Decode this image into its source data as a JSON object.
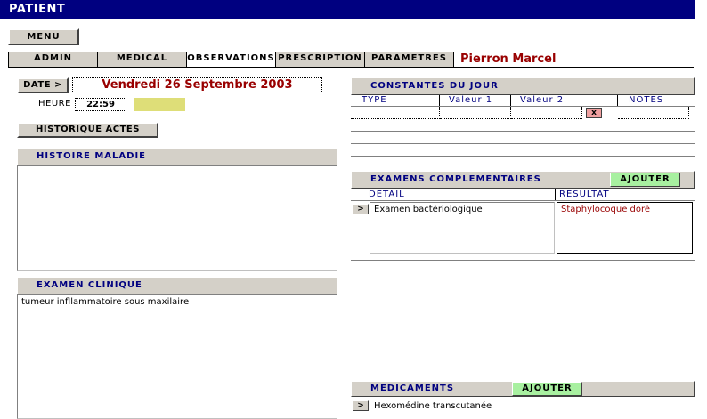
{
  "window": {
    "title": "PATIENT"
  },
  "menu_label": "MENU",
  "tabs": [
    {
      "label": "ADMIN"
    },
    {
      "label": "MEDICAL"
    },
    {
      "label": "OBSERVATIONS"
    },
    {
      "label": "PRESCRIPTION"
    },
    {
      "label": "PARAMETRES"
    }
  ],
  "patient_name": "Pierron Marcel",
  "date": {
    "button_label": "DATE >",
    "value": "Vendredi 26 Septembre 2003"
  },
  "heure": {
    "label": "HEURE",
    "value": "22:59"
  },
  "historique_label": "HISTORIQUE ACTES",
  "histoire_maladie": {
    "title": "HISTOIRE MALADIE",
    "text": ""
  },
  "examen_clinique": {
    "title": "EXAMEN CLINIQUE",
    "text": "tumeur infllammatoire sous maxilaire"
  },
  "constantes": {
    "title": "CONSTANTES DU JOUR",
    "columns": [
      "TYPE",
      "Valeur 1",
      "Valeur 2",
      "NOTES"
    ],
    "delete_label": "x"
  },
  "examens": {
    "title": "EXAMENS COMPLEMENTAIRES",
    "add_label": "AJOUTER",
    "columns": [
      "DETAIL",
      "RESULTAT"
    ],
    "row_arrow": ">",
    "detail": "Examen bactériologique",
    "resultat": "Staphylocoque doré"
  },
  "medicaments": {
    "title": "MEDICAMENTS",
    "add_label": "AJOUTER",
    "row_arrow": ">",
    "item": "Hexomédine transcutanée"
  },
  "colors": {
    "title_bg": "#000080",
    "accent_red": "#990000",
    "navy": "#000080",
    "highlight": "#dede78",
    "green": "#a8f0a0"
  }
}
